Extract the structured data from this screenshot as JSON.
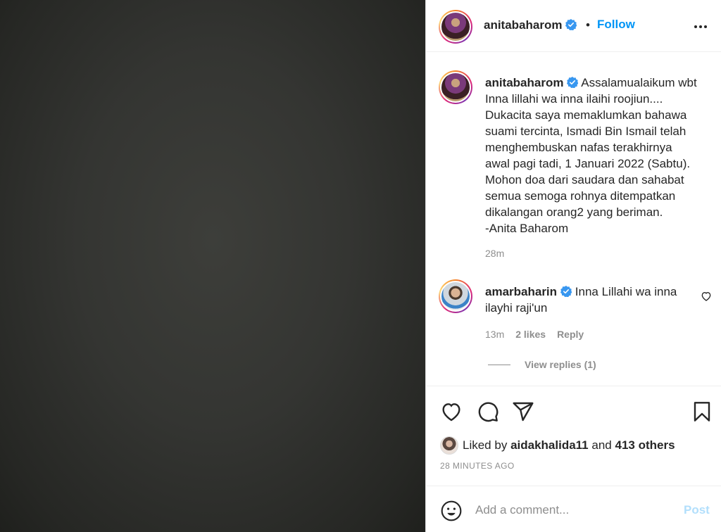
{
  "header": {
    "username": "anitabaharom",
    "separator": "•",
    "follow_label": "Follow"
  },
  "caption": {
    "username": "anitabaharom",
    "text": "Assalamualaikum wbt\nInna lillahi wa inna ilaihi roojiun....\nDukacita saya memaklumkan bahawa\nsuami tercinta, Ismadi Bin Ismail telah\nmenghembuskan nafas terakhirnya\nawal pagi tadi, 1 Januari 2022 (Sabtu).\nMohon doa dari saudara dan sahabat\nsemua semoga rohnya ditempatkan\ndikalangan orang2 yang beriman.\n-Anita Baharom",
    "time": "28m"
  },
  "comment": {
    "username": "amarbaharin",
    "text": "Inna Lillahi wa inna ilayhi raji'un",
    "time": "13m",
    "likes": "2 likes",
    "reply_label": "Reply",
    "view_replies": "View replies (1)"
  },
  "likes": {
    "prefix": "Liked by",
    "user": "aidakhalida11",
    "conj": "and",
    "others": "413 others"
  },
  "timestamp": "28 MINUTES AGO",
  "add_comment": {
    "placeholder": "Add a comment...",
    "post_label": "Post"
  },
  "colors": {
    "link": "#0095f6",
    "muted": "#8e8e8e",
    "post_disabled": "#b2dffc",
    "verified": "#3897f0"
  },
  "icons": [
    "verified-icon",
    "more-icon",
    "heart-icon",
    "comment-icon",
    "share-icon",
    "bookmark-icon",
    "emoji-icon"
  ]
}
